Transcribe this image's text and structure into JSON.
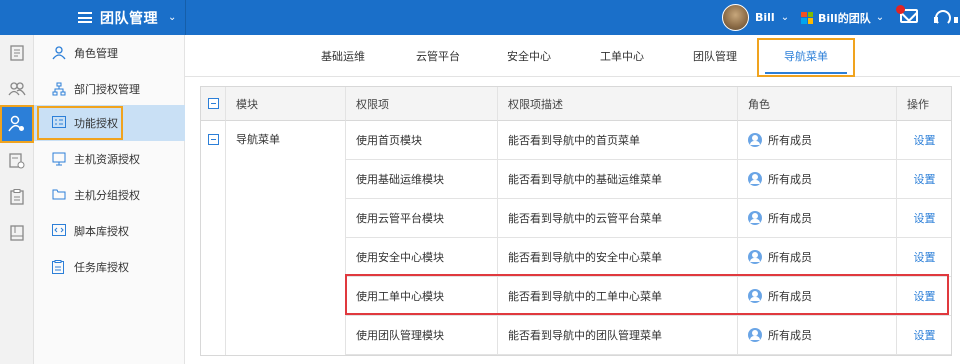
{
  "topbar": {
    "app_title": "团队管理",
    "user_name": "Bill",
    "team_name": "Bill的团队",
    "brand_color": "#1a6fc9"
  },
  "rail_icons": [
    "doc-icon",
    "users-icon",
    "user-settings-icon",
    "monitor-list-icon",
    "clipboard-icon",
    "book-icon"
  ],
  "submenu": {
    "items": [
      {
        "label": "角色管理",
        "icon": "user-icon"
      },
      {
        "label": "部门授权管理",
        "icon": "org-tree-icon"
      },
      {
        "label": "功能授权",
        "icon": "list-card-icon"
      },
      {
        "label": "主机资源授权",
        "icon": "monitor-icon"
      },
      {
        "label": "主机分组授权",
        "icon": "folder-icon"
      },
      {
        "label": "脚本库授权",
        "icon": "code-icon"
      },
      {
        "label": "任务库授权",
        "icon": "task-icon"
      }
    ]
  },
  "tabs": [
    "基础运维",
    "云管平台",
    "安全中心",
    "工单中心",
    "团队管理",
    "导航菜单"
  ],
  "table": {
    "headers": [
      "模块",
      "权限项",
      "权限项描述",
      "角色",
      "操作"
    ],
    "module": "导航菜单",
    "rows": [
      {
        "perm": "使用首页模块",
        "desc": "能否看到导航中的首页菜单",
        "role": "所有成员",
        "action": "设置"
      },
      {
        "perm": "使用基础运维模块",
        "desc": "能否看到导航中的基础运维菜单",
        "role": "所有成员",
        "action": "设置"
      },
      {
        "perm": "使用云管平台模块",
        "desc": "能否看到导航中的云管平台菜单",
        "role": "所有成员",
        "action": "设置"
      },
      {
        "perm": "使用安全中心模块",
        "desc": "能否看到导航中的安全中心菜单",
        "role": "所有成员",
        "action": "设置"
      },
      {
        "perm": "使用工单中心模块",
        "desc": "能否看到导航中的工单中心菜单",
        "role": "所有成员",
        "action": "设置"
      },
      {
        "perm": "使用团队管理模块",
        "desc": "能否看到导航中的团队管理菜单",
        "role": "所有成员",
        "action": "设置"
      }
    ]
  }
}
